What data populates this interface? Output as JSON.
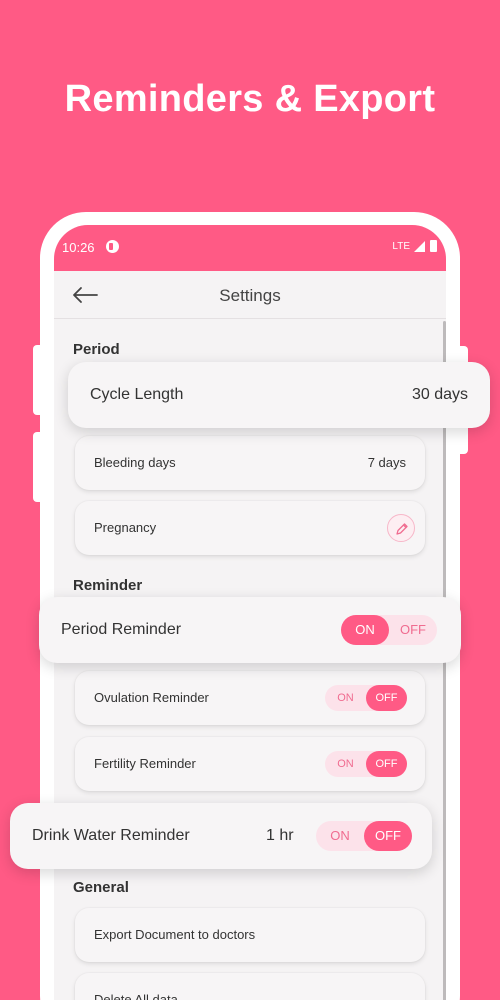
{
  "headline": "Reminders & Export",
  "status_bar": {
    "time": "10:26",
    "network": "LTE"
  },
  "app_bar": {
    "title": "Settings"
  },
  "sections": {
    "period": "Period",
    "reminder": "Reminder",
    "general": "General"
  },
  "period": {
    "cycle_length": {
      "label": "Cycle Length",
      "value": "30 days"
    },
    "bleeding_days": {
      "label": "Bleeding days",
      "value": "7 days"
    },
    "pregnancy": {
      "label": "Pregnancy"
    }
  },
  "reminders": {
    "period": {
      "label": "Period Reminder",
      "on": "ON",
      "off": "OFF",
      "state": "on"
    },
    "ovulation": {
      "label": "Ovulation Reminder",
      "on": "ON",
      "off": "OFF",
      "state": "off"
    },
    "fertility": {
      "label": "Fertility Reminder",
      "on": "ON",
      "off": "OFF",
      "state": "off"
    },
    "drink_water": {
      "label": "Drink Water Reminder",
      "interval": "1 hr",
      "on": "ON",
      "off": "OFF",
      "state": "off"
    }
  },
  "general": {
    "export": {
      "label": "Export Document to doctors"
    },
    "delete": {
      "label": "Delete All data"
    }
  },
  "colors": {
    "accent": "#FF5A85",
    "toggle_track": "#FCE2EA",
    "background": "#F5F3F4"
  },
  "icons": [
    "back-arrow-icon",
    "pencil-icon",
    "signal-icon",
    "battery-icon",
    "status-app-icon"
  ]
}
